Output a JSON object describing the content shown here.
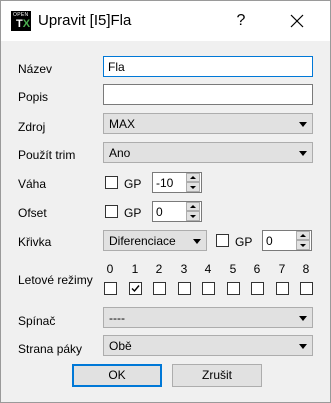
{
  "window": {
    "title": "Upravit [I5]Fla",
    "icon_line1": "OPEN",
    "icon_line2_a": "T",
    "icon_line2_b": "X",
    "help_label": "?"
  },
  "fields": {
    "nazev": {
      "label": "Název",
      "value": "Fla"
    },
    "popis": {
      "label": "Popis",
      "value": ""
    },
    "zdroj": {
      "label": "Zdroj",
      "value": "MAX"
    },
    "trim": {
      "label": "Použít trim",
      "value": "Ano"
    },
    "vaha": {
      "label": "Váha",
      "gp_label": "GP",
      "gp_checked": false,
      "value": "-10"
    },
    "ofset": {
      "label": "Ofset",
      "gp_label": "GP",
      "gp_checked": false,
      "value": "0"
    },
    "krivka": {
      "label": "Křivka",
      "type_value": "Diferenciace",
      "gp_label": "GP",
      "gp_checked": false,
      "value": "0"
    },
    "modes": {
      "label": "Letové režimy",
      "items": [
        {
          "num": "0",
          "checked": false
        },
        {
          "num": "1",
          "checked": true
        },
        {
          "num": "2",
          "checked": false
        },
        {
          "num": "3",
          "checked": false
        },
        {
          "num": "4",
          "checked": false
        },
        {
          "num": "5",
          "checked": false
        },
        {
          "num": "6",
          "checked": false
        },
        {
          "num": "7",
          "checked": false
        },
        {
          "num": "8",
          "checked": false
        }
      ]
    },
    "spinac": {
      "label": "Spínač",
      "value": "----"
    },
    "strana": {
      "label": "Strana páky",
      "value": "Obě"
    }
  },
  "buttons": {
    "ok": "OK",
    "cancel": "Zrušit"
  }
}
